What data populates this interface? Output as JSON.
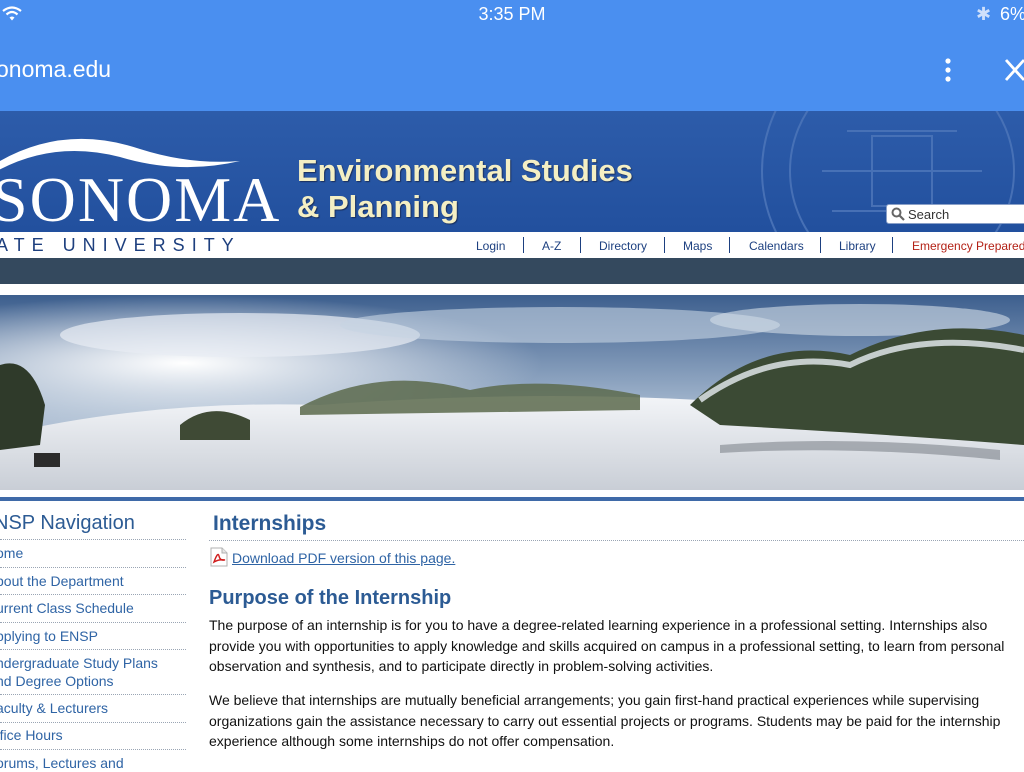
{
  "status": {
    "time": "3:35 PM",
    "battery": "6%"
  },
  "browser": {
    "url": "onoma.edu"
  },
  "header": {
    "logo_word": "SONOMA",
    "university": "ATE UNIVERSITY",
    "title_line1": "Environmental Studies",
    "title_line2": "& Planning",
    "search_placeholder": "Search"
  },
  "utility_links": [
    "Login",
    "A-Z",
    "Directory",
    "Maps",
    "Calendars",
    "Library",
    "Emergency Preparedn"
  ],
  "sidebar": {
    "title": "NSP Navigation",
    "items": [
      "Home",
      "About the Department",
      "Current Class Schedule",
      "Applying to ENSP",
      "Undergraduate Study Plans and Degree Options",
      "Faculty & Lecturers",
      "Office Hours",
      "Forums, Lectures and"
    ],
    "items_visible": [
      "ome",
      "bout the Department",
      "urrent Class Schedule",
      "pplying to ENSP",
      "ndergraduate Study Plans\nnd Degree Options",
      "aculty & Lecturers",
      "ffice Hours",
      "orums, Lectures and"
    ]
  },
  "main": {
    "title": "Internships",
    "pdf_link": "Download PDF version of this page.",
    "section_title": "Purpose of the Internship",
    "paragraphs": [
      "The purpose of an internship is for you to have a degree-related learning experience in a professional setting. Internships also provide you with opportunities to apply knowledge and skills acquired on campus in a professional setting, to learn from personal observation and synthesis, and to participate directly in problem-solving activities.",
      "We believe that internships are mutually beneficial arrangements; you gain first-hand practical experiences while supervising organizations gain the assistance necessary to carry out essential projects or programs. Students may be paid for the internship experience although some internships do not offer compensation."
    ]
  },
  "colors": {
    "browser_bar": "#4a8ff0",
    "header": "#2d5caa",
    "link": "#2f64a5",
    "heading": "#2c5b94",
    "nav_bar": "#34495e",
    "emergency": "#b32116"
  }
}
